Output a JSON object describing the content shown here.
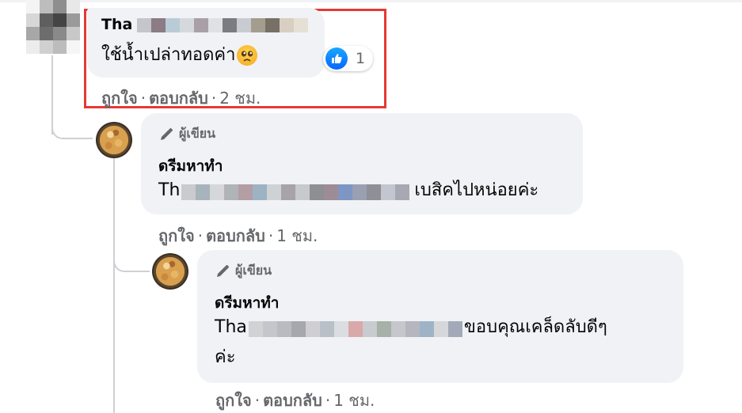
{
  "comment1": {
    "author_visible": "Tha",
    "text": "ใช้น้ำเปล่าทอดค่า",
    "emoji": "pleading-face",
    "reaction": {
      "icon": "like-icon",
      "count": "1"
    },
    "actions": {
      "like": "ถูกใจ",
      "reply": "ตอบกลับ",
      "time": "2 ชม."
    }
  },
  "reply1": {
    "badge": "ผู้เขียน",
    "author": "ดรีมหาทำ",
    "mention_visible": "Th",
    "text": "เบสิคไปหน่อยค่ะ",
    "actions": {
      "like": "ถูกใจ",
      "reply": "ตอบกลับ",
      "time": "1 ชม."
    }
  },
  "reply2": {
    "badge": "ผู้เขียน",
    "author": "ดรีมหาทำ",
    "mention_visible": "Tha",
    "text_line1": "ขอบคุณเคล็ดลับดีๆ",
    "text_line2": "ค่ะ",
    "actions": {
      "like": "ถูกใจ",
      "reply": "ตอบกลับ",
      "time": "1 ชม."
    }
  },
  "colors": {
    "bubble": "#f0f2f5",
    "secondary_text": "#65676b",
    "highlight": "#e53935",
    "like_blue": "#0866ff"
  }
}
